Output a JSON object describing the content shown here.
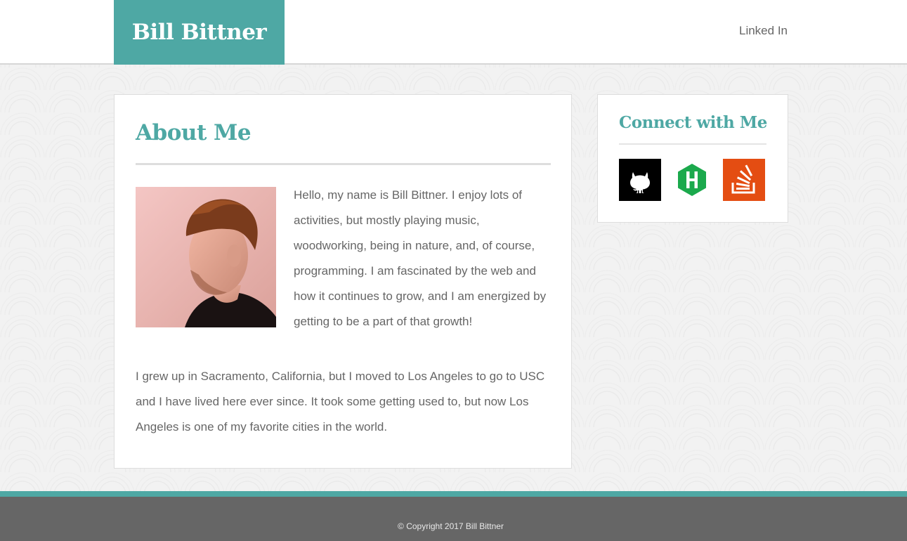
{
  "header": {
    "brand": "Bill Bittner",
    "nav_link": "Linked In"
  },
  "about": {
    "title": "About Me",
    "photo_alt": "Bill Bittner portrait",
    "paragraph_1": "Hello, my name is Bill Bittner. I enjoy lots of activities, but mostly playing music, woodworking, being in nature, and, of course, programming. I am fascinated by the web and how it continues to grow, and I am energized by getting to be a part of that growth!",
    "paragraph_2": "I grew up in Sacramento, California, but I moved to Los Angeles to go to USC and I have lived here ever since. It took some getting used to, but now Los Angeles is one of my favorite cities in the world."
  },
  "connect": {
    "title": "Connect with Me",
    "links": [
      {
        "icon": "github-icon",
        "color": "#000000"
      },
      {
        "icon": "hackerrank-icon",
        "color": "#1ba94c"
      },
      {
        "icon": "stackoverflow-icon",
        "color": "#e44d12"
      }
    ]
  },
  "footer": {
    "copyright": "© Copyright 2017 Bill Bittner"
  },
  "colors": {
    "accent": "#4ea8a4",
    "footer_bg": "#666666",
    "text": "#666666"
  }
}
